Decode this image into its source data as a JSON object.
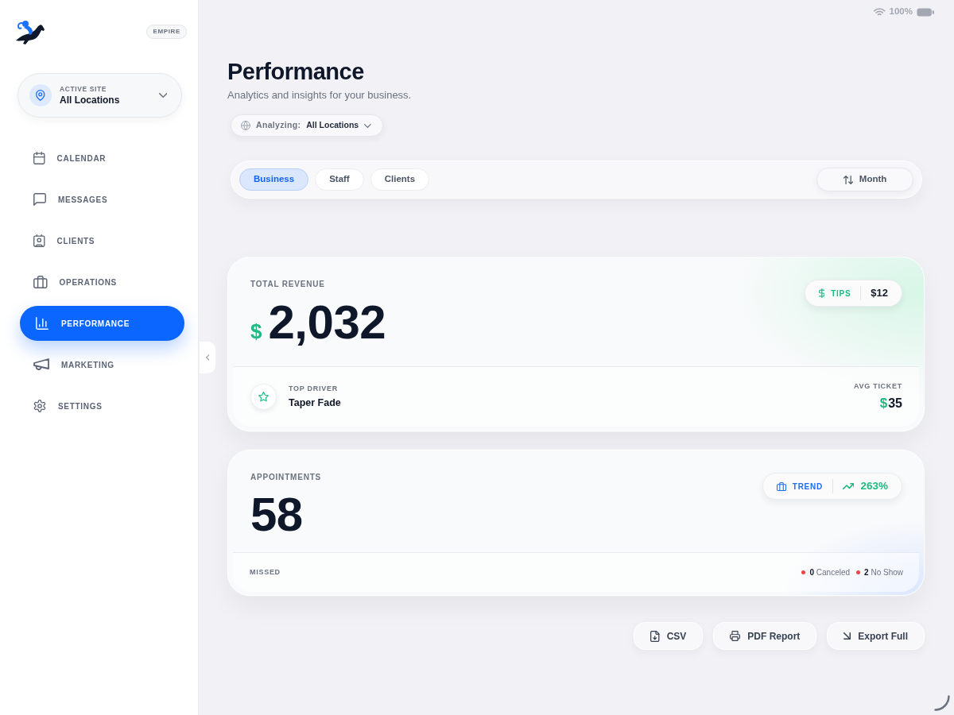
{
  "status_bar": {
    "battery": "100%"
  },
  "sidebar": {
    "badge": "EMPIRE",
    "site_switcher": {
      "label": "ACTIVE SITE",
      "value": "All Locations"
    },
    "nav": [
      {
        "label": "CALENDAR",
        "selected": false
      },
      {
        "label": "MESSAGES",
        "selected": false
      },
      {
        "label": "CLIENTS",
        "selected": false
      },
      {
        "label": "OPERATIONS",
        "selected": false
      },
      {
        "label": "PERFORMANCE",
        "selected": true
      },
      {
        "label": "MARKETING",
        "selected": false
      },
      {
        "label": "SETTINGS",
        "selected": false
      }
    ]
  },
  "header": {
    "title": "Performance",
    "subtitle": "Analytics and insights for your business.",
    "filter": {
      "label": "Analyzing:",
      "value": "All Locations"
    }
  },
  "tabs": [
    {
      "label": "Business",
      "selected": true
    },
    {
      "label": "Staff",
      "selected": false
    },
    {
      "label": "Clients",
      "selected": false
    }
  ],
  "period_button": {
    "label": "Month"
  },
  "revenue_card": {
    "label": "TOTAL REVENUE",
    "currency": "$",
    "amount": "2,032",
    "tips": {
      "label": "TIPS",
      "amount": "$12"
    },
    "top_driver": {
      "label": "TOP DRIVER",
      "value": "Taper Fade"
    },
    "avg_ticket": {
      "label": "AVG TICKET",
      "currency": "$",
      "amount": "35"
    }
  },
  "appointments_card": {
    "label": "APPOINTMENTS",
    "count": "58",
    "trend": {
      "label": "TREND",
      "value": "263%"
    },
    "missed": {
      "label": "MISSED",
      "items": [
        {
          "text": "**0** Canceled"
        },
        {
          "text": "**2** No Show"
        }
      ]
    }
  },
  "export_buttons": [
    {
      "label": "CSV"
    },
    {
      "label": "PDF Report"
    },
    {
      "label": "Export Full"
    }
  ]
}
